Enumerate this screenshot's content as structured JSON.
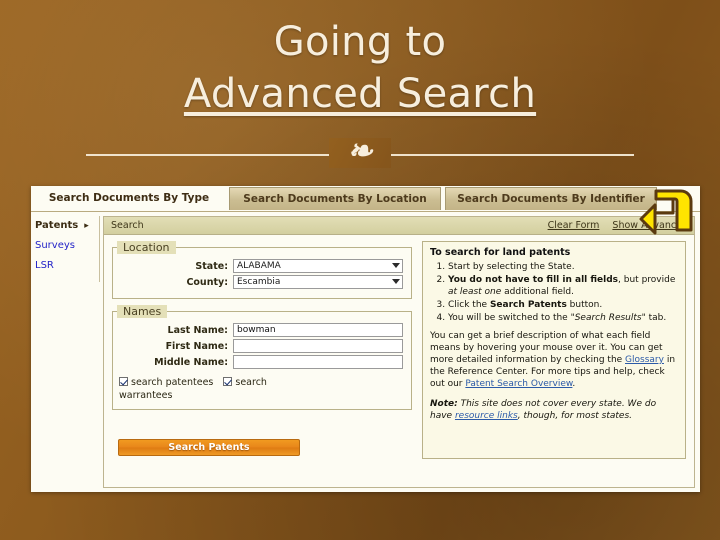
{
  "slide": {
    "title_line1": "Going to",
    "title_line2": "Advanced Search",
    "ornament": "❧",
    "background_color": "#8b5a1e",
    "title_color": "#f7eedd"
  },
  "screenshot": {
    "tabs": [
      {
        "label": "Search Documents By Type",
        "active": true
      },
      {
        "label": "Search Documents By Location",
        "active": false
      },
      {
        "label": "Search Documents By Identifier",
        "active": false
      }
    ],
    "sidebar": {
      "items": [
        {
          "label": "Patents",
          "caret": "▸",
          "current": true
        },
        {
          "label": "Surveys",
          "current": false
        },
        {
          "label": "LSR",
          "current": false
        }
      ]
    },
    "card_header": {
      "label": "Search",
      "clear_form_label": "Clear Form",
      "show_advanced_label": "Show Advanced"
    },
    "location_fieldset": {
      "legend": "Location",
      "state_label": "State:",
      "state_value": "ALABAMA",
      "county_label": "County:",
      "county_value": "Escambia"
    },
    "names_fieldset": {
      "legend": "Names",
      "last_name_label": "Last Name:",
      "last_name_value": "bowman",
      "first_name_label": "First Name:",
      "first_name_value": "",
      "middle_name_label": "Middle Name:",
      "middle_name_value": ""
    },
    "checkboxes": [
      {
        "label": "search patentees",
        "checked": true
      },
      {
        "label": "search warrantees",
        "checked": true
      }
    ],
    "search_button_label": "Search Patents",
    "info_panel": {
      "heading": "To search for land patents",
      "steps_1": "Start by selecting the State.",
      "step2_bold": "You do not have to fill in all fields",
      "step2_mid": ", but provide ",
      "step2_italic": "at least one",
      "step2_end": " additional field.",
      "step3_pre": "Click the ",
      "step3_bold": "Search Patents",
      "step3_post": " button.",
      "step4_pre": "You will be switched to the \"",
      "step4_italic": "Search Results",
      "step4_post": "\" tab.",
      "para_1": "You can get a brief description of what each field means by hovering your mouse over it. You can get more detailed information by checking the ",
      "glossary_link": "Glossary",
      "para_2": " in the Reference Center. For more tips and help, check out our ",
      "overview_link": "Patent Search Overview",
      "para_3": ".",
      "note_label": "Note:",
      "note_text_1": " This site does not cover every state. We do have ",
      "note_link": "resource links",
      "note_text_2": ", though, for most states."
    },
    "annotation": {
      "name": "yellow-u-turn-arrow",
      "fill_color": "#ffe400",
      "stroke_color": "#5b3a10"
    }
  }
}
